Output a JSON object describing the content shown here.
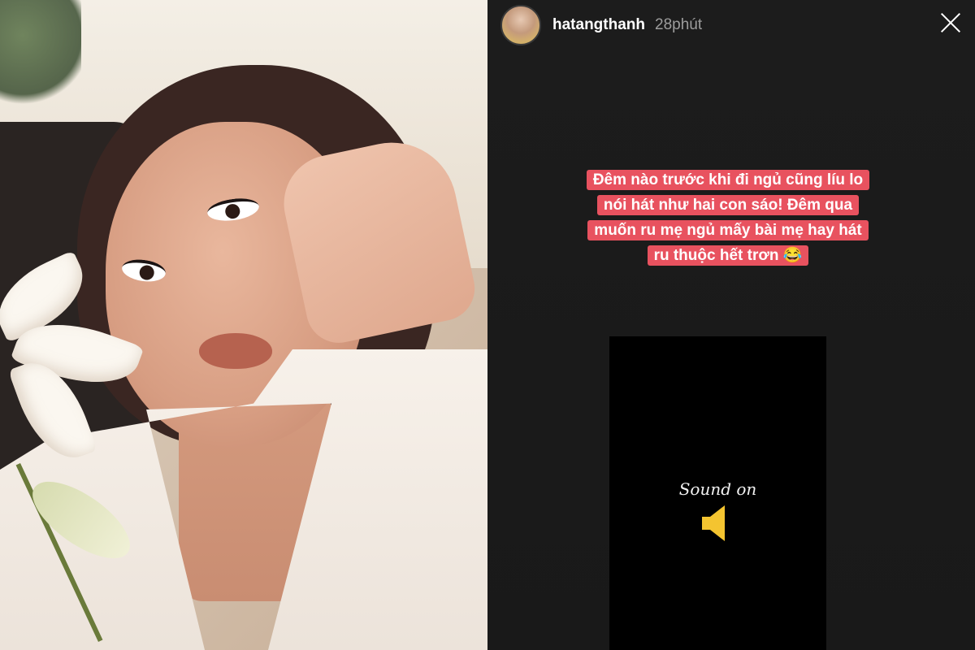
{
  "story": {
    "username": "hatangthanh",
    "time": "28phút",
    "caption_lines": [
      "Đêm nào trước khi đi ngủ cũng líu lo",
      "nói hát như hai con sáo! Đêm qua",
      "muốn ru mẹ ngủ mấy bài mẹ hay hát",
      "ru thuộc hết trơn 😂"
    ],
    "caption_color": "#e8525f",
    "video": {
      "sound_label": "Sound on",
      "icon": "speaker-icon",
      "icon_color": "#f4c430"
    }
  }
}
